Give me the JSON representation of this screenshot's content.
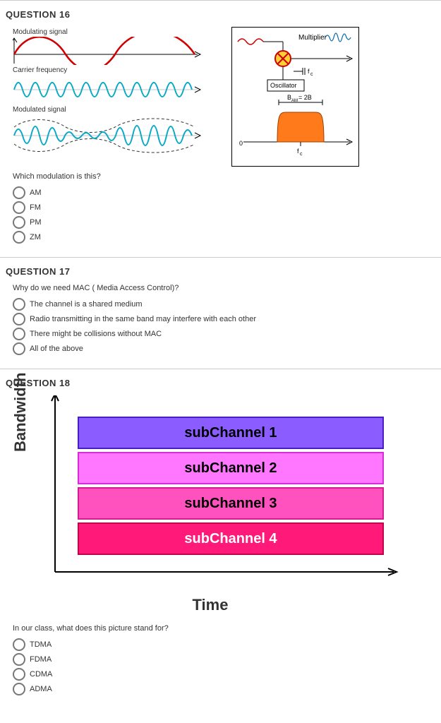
{
  "q16": {
    "title": "QUESTION 16",
    "labels": {
      "modulating": "Modulating signal",
      "carrier": "Carrier frequency",
      "modulated": "Modulated signal",
      "multiplier": "Multiplier",
      "oscillator": "Oscillator",
      "bam": "B_AM = 2B",
      "fc": "f_c",
      "zero": "0"
    },
    "prompt": "Which modulation is this?",
    "options": [
      "AM",
      "FM",
      "PM",
      "ZM"
    ]
  },
  "q17": {
    "title": "QUESTION 17",
    "prompt": "Why do we need MAC ( Media Access Control)?",
    "options": [
      "The channel is a shared medium",
      "Radio transmitting in the same band may interfere with each other",
      "There might be collisions without MAC",
      "All of the above"
    ]
  },
  "q18": {
    "title": "QUESTION 18",
    "ylabel": "Bandwidth",
    "xlabel": "Time",
    "bars": [
      "subChannel 1",
      "subChannel 2",
      "subChannel 3",
      "subChannel 4"
    ],
    "prompt": "In our class, what does this picture stand for?",
    "options": [
      "TDMA",
      "FDMA",
      "CDMA",
      "ADMA"
    ]
  }
}
